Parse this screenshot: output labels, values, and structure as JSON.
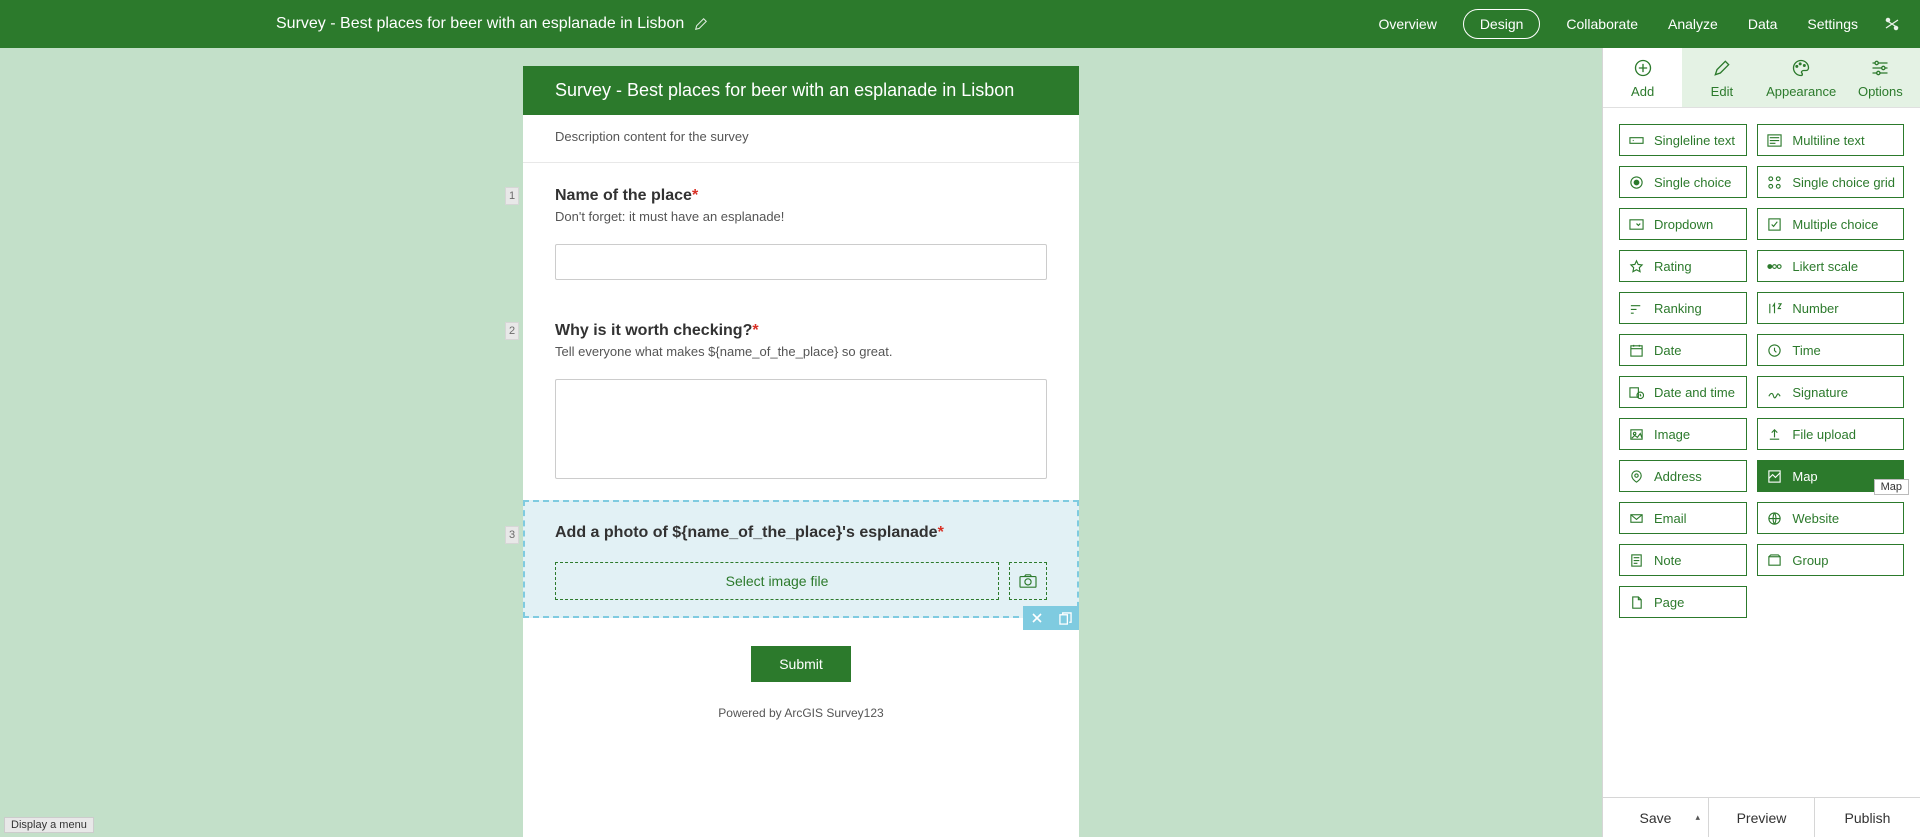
{
  "header": {
    "title": "Survey - Best places for beer with an esplanade in Lisbon",
    "nav": [
      "Overview",
      "Design",
      "Collaborate",
      "Analyze",
      "Data",
      "Settings"
    ],
    "active_nav": "Design"
  },
  "survey": {
    "title": "Survey - Best places for beer with an esplanade in Lisbon",
    "description": "Description content for the survey",
    "questions": [
      {
        "num": "1",
        "label": "Name of the place",
        "required": true,
        "hint": "Don't forget: it must have an esplanade!",
        "type": "singleline",
        "value": ""
      },
      {
        "num": "2",
        "label": "Why is it worth checking?",
        "required": true,
        "hint": "Tell everyone what makes ${name_of_the_place} so great.",
        "type": "multiline",
        "value": ""
      },
      {
        "num": "3",
        "label": "Add a photo of ${name_of_the_place}'s esplanade",
        "required": true,
        "hint": "",
        "type": "image",
        "select_label": "Select image file",
        "selected": true
      }
    ],
    "submit_label": "Submit",
    "powered": "Powered by ArcGIS Survey123"
  },
  "side": {
    "tabs": [
      "Add",
      "Edit",
      "Appearance",
      "Options"
    ],
    "active_tab": "Add",
    "qtypes": [
      {
        "label": "Singleline text",
        "icon": "singleline"
      },
      {
        "label": "Multiline text",
        "icon": "multiline"
      },
      {
        "label": "Single choice",
        "icon": "radio"
      },
      {
        "label": "Single choice grid",
        "icon": "radiogrid"
      },
      {
        "label": "Dropdown",
        "icon": "dropdown"
      },
      {
        "label": "Multiple choice",
        "icon": "checkbox"
      },
      {
        "label": "Rating",
        "icon": "star"
      },
      {
        "label": "Likert scale",
        "icon": "likert"
      },
      {
        "label": "Ranking",
        "icon": "ranking"
      },
      {
        "label": "Number",
        "icon": "number"
      },
      {
        "label": "Date",
        "icon": "date"
      },
      {
        "label": "Time",
        "icon": "time"
      },
      {
        "label": "Date and time",
        "icon": "datetime"
      },
      {
        "label": "Signature",
        "icon": "signature"
      },
      {
        "label": "Image",
        "icon": "image"
      },
      {
        "label": "File upload",
        "icon": "upload"
      },
      {
        "label": "Address",
        "icon": "address"
      },
      {
        "label": "Map",
        "icon": "map",
        "selected": true,
        "tooltip": "Map"
      },
      {
        "label": "Email",
        "icon": "email"
      },
      {
        "label": "Website",
        "icon": "website"
      },
      {
        "label": "Note",
        "icon": "note"
      },
      {
        "label": "Group",
        "icon": "group"
      },
      {
        "label": "Page",
        "icon": "page"
      }
    ],
    "footer": {
      "save": "Save",
      "preview": "Preview",
      "publish": "Publish"
    }
  },
  "status_bar": "Display a menu"
}
